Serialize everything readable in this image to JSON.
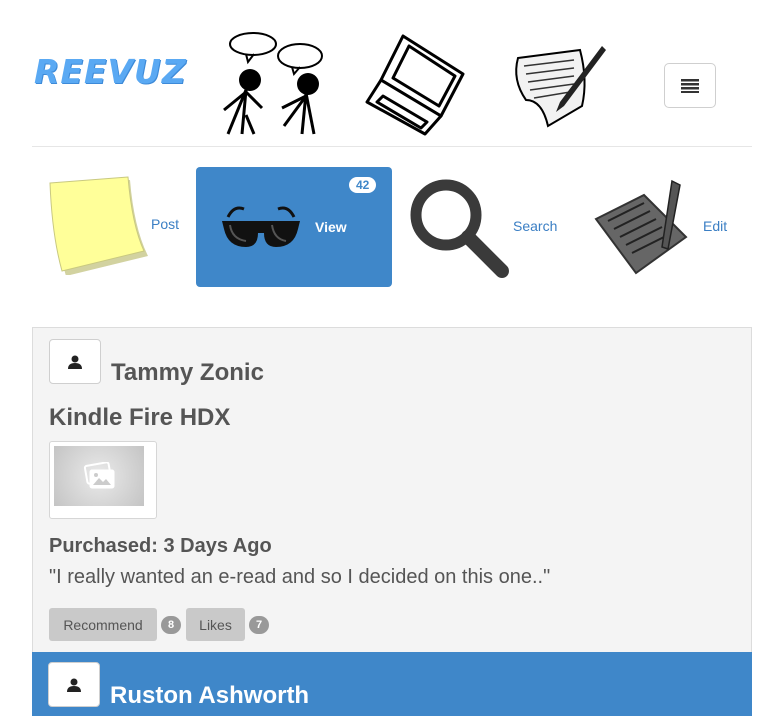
{
  "brand": {
    "logo_text": "REEVUZ"
  },
  "header": {
    "art": [
      "conversation-icon",
      "laptop-icon",
      "document-pen-icon"
    ],
    "menu_icon": "hamburger-menu-icon"
  },
  "nav": {
    "items": [
      {
        "label": "Post",
        "icon": "sticky-note-icon",
        "active": false
      },
      {
        "label": "View",
        "icon": "sunglasses-icon",
        "active": true,
        "badge": "42"
      },
      {
        "label": "Search",
        "icon": "magnifier-icon",
        "active": false
      },
      {
        "label": "Edit",
        "icon": "notepad-pencil-icon",
        "active": false
      }
    ]
  },
  "feed": {
    "posts": [
      {
        "user": "Tammy Zonic",
        "product": "Kindle Fire HDX",
        "purchased": "Purchased: 3 Days Ago",
        "quote": "\"I really wanted an e-read and so I decided on this one..\"",
        "recommend_label": "Recommend",
        "recommend_count": "8",
        "likes_label": "Likes",
        "likes_count": "7"
      },
      {
        "user": "Ruston Ashworth"
      }
    ]
  },
  "colors": {
    "accent": "#3f87c9",
    "brand": "#5aa9f3",
    "card_bg": "#f4f4f4"
  }
}
